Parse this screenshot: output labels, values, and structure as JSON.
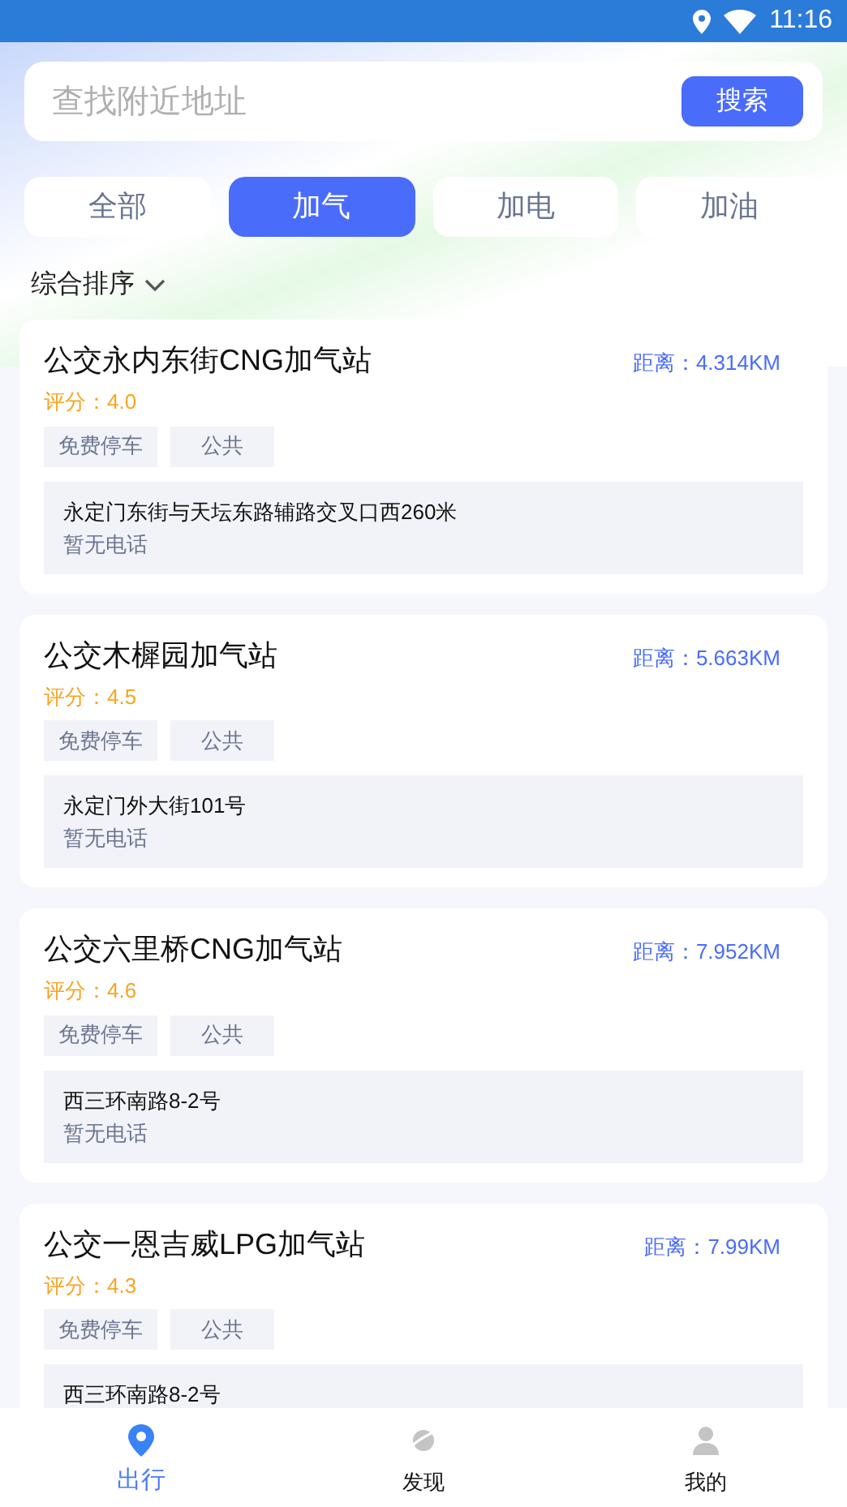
{
  "status_bar": {
    "time": "11:16"
  },
  "search": {
    "placeholder": "查找附近地址",
    "button": "搜索"
  },
  "tabs": [
    {
      "label": "全部",
      "selected": false
    },
    {
      "label": "加气",
      "selected": true
    },
    {
      "label": "加电",
      "selected": false
    },
    {
      "label": "加油",
      "selected": false
    }
  ],
  "sort": {
    "label": "综合排序"
  },
  "stations": [
    {
      "name": "公交永内东街CNG加气站",
      "distance": "距离：4.314KM",
      "rating": "评分：4.0",
      "tags": [
        "免费停车",
        "公共"
      ],
      "address": "永定门东街与天坛东路辅路交叉口西260米",
      "phone": "暂无电话"
    },
    {
      "name": "公交木樨园加气站",
      "distance": "距离：5.663KM",
      "rating": "评分：4.5",
      "tags": [
        "免费停车",
        "公共"
      ],
      "address": "永定门外大街101号",
      "phone": "暂无电话"
    },
    {
      "name": "公交六里桥CNG加气站",
      "distance": "距离：7.952KM",
      "rating": "评分：4.6",
      "tags": [
        "免费停车",
        "公共"
      ],
      "address": "西三环南路8-2号",
      "phone": "暂无电话"
    },
    {
      "name": "公交一恩吉威LPG加气站",
      "distance": "距离：7.99KM",
      "rating": "评分：4.3",
      "tags": [
        "免费停车",
        "公共"
      ],
      "address": "西三环南路8-2号"
    }
  ],
  "nav": [
    {
      "label": "出行",
      "kind": "pin",
      "selected": true
    },
    {
      "label": "发现",
      "kind": "planet",
      "selected": false
    },
    {
      "label": "我的",
      "kind": "person",
      "selected": false
    }
  ]
}
